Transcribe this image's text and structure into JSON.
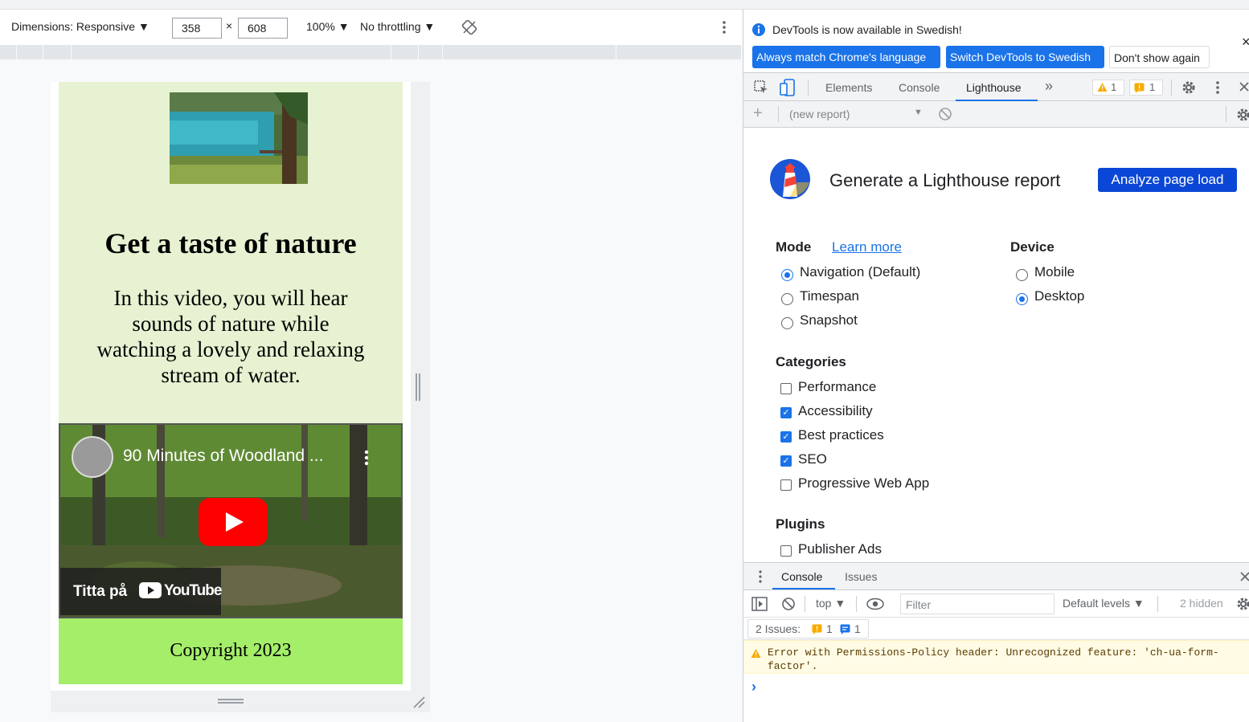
{
  "device_toolbar": {
    "dimensions_label": "Dimensions: Responsive ▼",
    "width": "358",
    "times": "×",
    "height": "608",
    "zoom": "100% ▼",
    "throttling": "No throttling ▼"
  },
  "page": {
    "heading": "Get a taste of nature",
    "paragraph": "In this video, you will hear sounds of nature while watching a lovely and relaxing stream of water.",
    "video": {
      "title": "90 Minutes of Woodland ...",
      "watch_on": "Titta på",
      "brand": "YouTube"
    },
    "copyright": "Copyright 2023"
  },
  "infobar": {
    "message": "DevTools is now available in Swedish!",
    "btn_match": "Always match Chrome's language",
    "btn_switch": "Switch DevTools to Swedish",
    "btn_dismiss": "Don't show again",
    "close": "×"
  },
  "tabs": {
    "elements": "Elements",
    "console": "Console",
    "lighthouse": "Lighthouse",
    "more": "»",
    "warn_count": "1",
    "issue_count": "1"
  },
  "subbar": {
    "new_report": "(new report)"
  },
  "lighthouse": {
    "title": "Generate a Lighthouse report",
    "analyze": "Analyze page load",
    "mode_label": "Mode",
    "learn_more": "Learn more",
    "modes": [
      "Navigation (Default)",
      "Timespan",
      "Snapshot"
    ],
    "selected_mode": "Navigation (Default)",
    "device_label": "Device",
    "devices": [
      "Mobile",
      "Desktop"
    ],
    "selected_device": "Desktop",
    "categories_label": "Categories",
    "categories": [
      {
        "label": "Performance",
        "checked": false
      },
      {
        "label": "Accessibility",
        "checked": true
      },
      {
        "label": "Best practices",
        "checked": true
      },
      {
        "label": "SEO",
        "checked": true
      },
      {
        "label": "Progressive Web App",
        "checked": false
      }
    ],
    "plugins_label": "Plugins",
    "plugins": [
      {
        "label": "Publisher Ads",
        "checked": false
      }
    ]
  },
  "drawer": {
    "tab_console": "Console",
    "tab_issues": "Issues",
    "context": "top ▼",
    "filter_placeholder": "Filter",
    "levels": "Default levels ▼",
    "hidden": "2 hidden",
    "issues_label": "2 Issues:",
    "issues_warn": "1",
    "issues_info": "1",
    "warning_message": "Error with Permissions-Policy header: Unrecognized feature: 'ch-ua-form-factor'.",
    "prompt": "›"
  },
  "colors": {
    "accent": "#1a73e8",
    "page_bg": "#e6f2d1",
    "footer_bg": "#a4ee6a",
    "lighthouse_button": "#0b47d6"
  }
}
